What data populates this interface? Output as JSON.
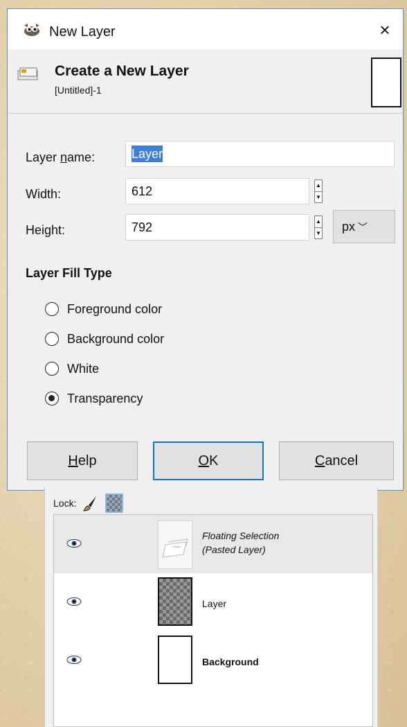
{
  "dialog": {
    "window_title": "New Layer",
    "close_glyph": "×",
    "header_title": "Create a New Layer",
    "header_subtitle": "[Untitled]-1",
    "layer_name_label": "Layer name:",
    "layer_name_value": "Layer",
    "width_label": "Width:",
    "width_value": "612",
    "height_label": "Height:",
    "height_value": "792",
    "unit": "px",
    "fill_type_title": "Layer Fill Type",
    "fill_options": [
      {
        "label": "Foreground color",
        "selected": false
      },
      {
        "label": "Background color",
        "selected": false
      },
      {
        "label": "White",
        "selected": false
      },
      {
        "label": "Transparency",
        "selected": true
      }
    ],
    "buttons": {
      "help": "Help",
      "ok": "OK",
      "cancel": "Cancel"
    },
    "icons": {
      "title": "gimp-wilber-icon",
      "header": "layer-icon",
      "close": "close-icon"
    }
  },
  "layers_panel": {
    "lock_label": "Lock:",
    "lock_icons": [
      "paintbrush-icon",
      "alpha-lock-icon"
    ],
    "layers": [
      {
        "name_line1": "Floating Selection",
        "name_line2": "(Pasted Layer)",
        "visible": true,
        "selected": true,
        "style": "italic"
      },
      {
        "name_line1": "Layer",
        "name_line2": "",
        "visible": true,
        "selected": false,
        "style": "normal"
      },
      {
        "name_line1": "Background",
        "name_line2": "",
        "visible": true,
        "selected": false,
        "style": "bold"
      }
    ]
  },
  "colors": {
    "dialog_border": "#5d8fc9",
    "selection_highlight": "#3b7fd7",
    "default_button_border": "#0078d7",
    "background": "#e2cfa9"
  }
}
